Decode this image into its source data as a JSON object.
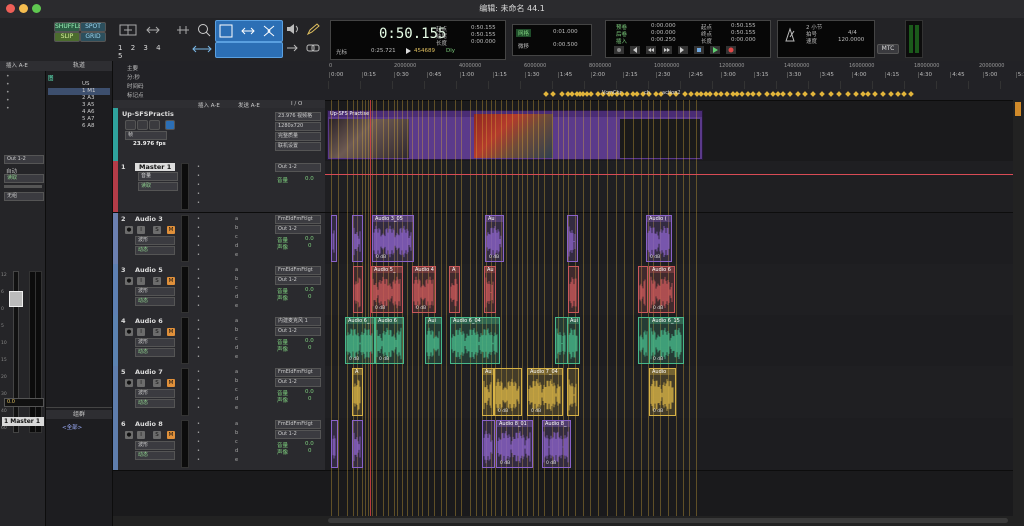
{
  "window": {
    "title": "编辑: 未命名 44.1"
  },
  "toolbar": {
    "edit_modes": [
      "SHUFFLE",
      "SPOT",
      "SLIP",
      "GRID"
    ],
    "zoom_presets": [
      "1",
      "2",
      "3",
      "4",
      "5"
    ],
    "counter": {
      "main": "0:50.155",
      "secondary": "0:25.721",
      "samples": "454689",
      "offset_label": "光标",
      "dly_label": "Dly"
    },
    "selection": {
      "start_label": "起点",
      "end_label": "结尾",
      "length_label": "长度",
      "start": "0:50.155",
      "end": "0:50.155",
      "length": "0:00.000"
    },
    "grid": {
      "label": "网格",
      "value": "0:01.000"
    },
    "nudge": {
      "label": "微移",
      "value": "0:00.500"
    },
    "transport_left": {
      "labels": [
        "预卷",
        "后卷",
        "插入"
      ],
      "values": [
        "0:00.000",
        "0:00.000",
        "0:00.250"
      ]
    },
    "transport_right": {
      "labels": [
        "起点",
        "终点",
        "长度"
      ],
      "values": [
        "0:50.155",
        "0:50.155",
        "0:00.000"
      ]
    },
    "meter": {
      "bars_label": "2 小节",
      "meter_label": "拍号",
      "meter_value": "4/4",
      "tempo_label": "速度",
      "tempo_value": "120.0000"
    },
    "mtc_label": "MTC"
  },
  "left_panel": {
    "insert_header": "插入 A-E",
    "output": "Out 1-2",
    "auto_label": "自动",
    "auto_mode": "读取",
    "group_label": "无组",
    "fader_value": "0.0",
    "master_label": "1 Master 1",
    "scale": [
      "12",
      "6",
      "0",
      "5",
      "10",
      "15",
      "20",
      "30",
      "40",
      "60"
    ]
  },
  "track_list": {
    "header": "轨道",
    "items": [
      "图",
      "US",
      "1 M1",
      "2 A3",
      "3 A5",
      "4 A6",
      "5 A7",
      "6 A8"
    ]
  },
  "groups": {
    "header": "组群",
    "item": "<全部>"
  },
  "columns": {
    "inserts": "插入 A-E",
    "sends": "发送 A-E",
    "io": "I / O"
  },
  "video_track": {
    "name": "Up-SFSPractis",
    "rate_label": "23.976 fps",
    "fps_setting": "23.976 视频格",
    "resolution": "1280x720",
    "quality": "完整质量",
    "online": "联机设置",
    "clip_label": "Up-SFS Practise",
    "mode_label": "帧"
  },
  "ruler": {
    "labels": [
      "主要",
      "分:秒",
      "时间码",
      "标记点"
    ],
    "minsec_ticks": [
      "0:00",
      "0:15",
      "0:30",
      "0:45",
      "1:00",
      "1:15",
      "1:30",
      "1:45",
      "2:00",
      "2:15",
      "2:30",
      "2:45",
      "3:00",
      "3:15",
      "3:30",
      "3:45",
      "4:00",
      "4:15",
      "4:30",
      "4:45",
      "5:00",
      "5:15",
      "5:30",
      "5:45",
      "6:00",
      "6:15",
      "6:30",
      "6:45",
      "7:00",
      "7:15",
      "7:30",
      "7:45",
      "8:00"
    ],
    "samples_ticks": [
      "0",
      "2000000",
      "4000000",
      "6000000",
      "8000000",
      "10000000",
      "12000000",
      "14000000",
      "16000000",
      "18000000",
      "20000000"
    ],
    "marker_texts": [
      "VcmChr",
      "ch",
      "action2"
    ]
  },
  "tracks": [
    {
      "num": "1",
      "name": "Master 1",
      "color": "#b43c48",
      "io_out": "Out 1-2",
      "vol_label": "音量",
      "vol": "0.0",
      "send_letters": [],
      "automation": "音量",
      "auto_mode": "读取",
      "kind": "master"
    },
    {
      "num": "2",
      "name": "Audio 3",
      "color": "#6b7fb0",
      "io_in": "FmEIdFmFtIgt",
      "io_out": "Out 1-2",
      "vol_label": "音量",
      "vol": "0.0",
      "pan_label": "声像",
      "pan": "0",
      "waveform_label": "波形",
      "auto_mode": "动态",
      "send_letters": [
        "a",
        "b",
        "c",
        "d",
        "e"
      ],
      "kind": "audio"
    },
    {
      "num": "3",
      "name": "Audio 5",
      "color": "#5d7fb2",
      "io_in": "FmEIdFmFtIgt",
      "io_out": "Out 1-2",
      "vol_label": "音量",
      "vol": "0.0",
      "pan_label": "声像",
      "pan": "0",
      "waveform_label": "波形",
      "auto_mode": "动态",
      "send_letters": [
        "a",
        "b",
        "c",
        "d",
        "e"
      ],
      "kind": "audio"
    },
    {
      "num": "4",
      "name": "Audio 6",
      "color": "#5b82b0",
      "io_in": "内建麦克风 1",
      "io_out": "Out 1-2",
      "vol_label": "音量",
      "vol": "0.0",
      "pan_label": "声像",
      "pan": "0",
      "waveform_label": "波形",
      "auto_mode": "动态",
      "send_letters": [
        "a",
        "b",
        "c",
        "d",
        "e"
      ],
      "kind": "audio"
    },
    {
      "num": "5",
      "name": "Audio 7",
      "color": "#5e7dad",
      "io_in": "FmEIdFmFtIgt",
      "io_out": "Out 1-2",
      "vol_label": "音量",
      "vol": "0.0",
      "pan_label": "声像",
      "pan": "0",
      "waveform_label": "波形",
      "auto_mode": "动态",
      "send_letters": [
        "a",
        "b",
        "c",
        "d",
        "e"
      ],
      "kind": "audio"
    },
    {
      "num": "6",
      "name": "Audio 8",
      "color": "#5e7dad",
      "io_in": "FmEIdFmFtIgt",
      "io_out": "Out 1-2",
      "vol_label": "音量",
      "vol": "0.0",
      "pan_label": "声像",
      "pan": "0",
      "waveform_label": "波形",
      "auto_mode": "动态",
      "send_letters": [
        "a",
        "b",
        "c",
        "d",
        "e"
      ],
      "kind": "audio"
    }
  ],
  "clip_labels": {
    "audio3": [
      "Audio 3_05",
      "Au",
      "Audio (",
      "0 dB",
      "0 dB",
      "0 dB"
    ],
    "audio5": [
      "Audio 5_",
      "Audio 4",
      "A",
      "Au",
      "Audio 6",
      "0 dB",
      "0 dB",
      "0 dB"
    ],
    "audio6": [
      "Audio 6_",
      "Audio 6",
      "Aui",
      "Audio 6_04",
      "Aui",
      "Audio 6_15",
      "0 dB",
      "0 dB",
      "0 dB"
    ],
    "audio7": [
      "A",
      "Au",
      "Audio 7_04",
      "Audio",
      "0 dB",
      "0 dB",
      "0 dB"
    ],
    "audio8": [
      "Audio 8_01",
      "Audio 8_",
      "0 dB",
      "0 dB"
    ]
  },
  "colors": {
    "audio3": "#8a62c8",
    "audio5": "#c8585a",
    "audio6": "#47b88a",
    "audio7": "#d7b246",
    "audio8": "#8a62c8",
    "video": "#6a3f98",
    "playhead": "#e0424a",
    "marker": "#e2b53b"
  }
}
